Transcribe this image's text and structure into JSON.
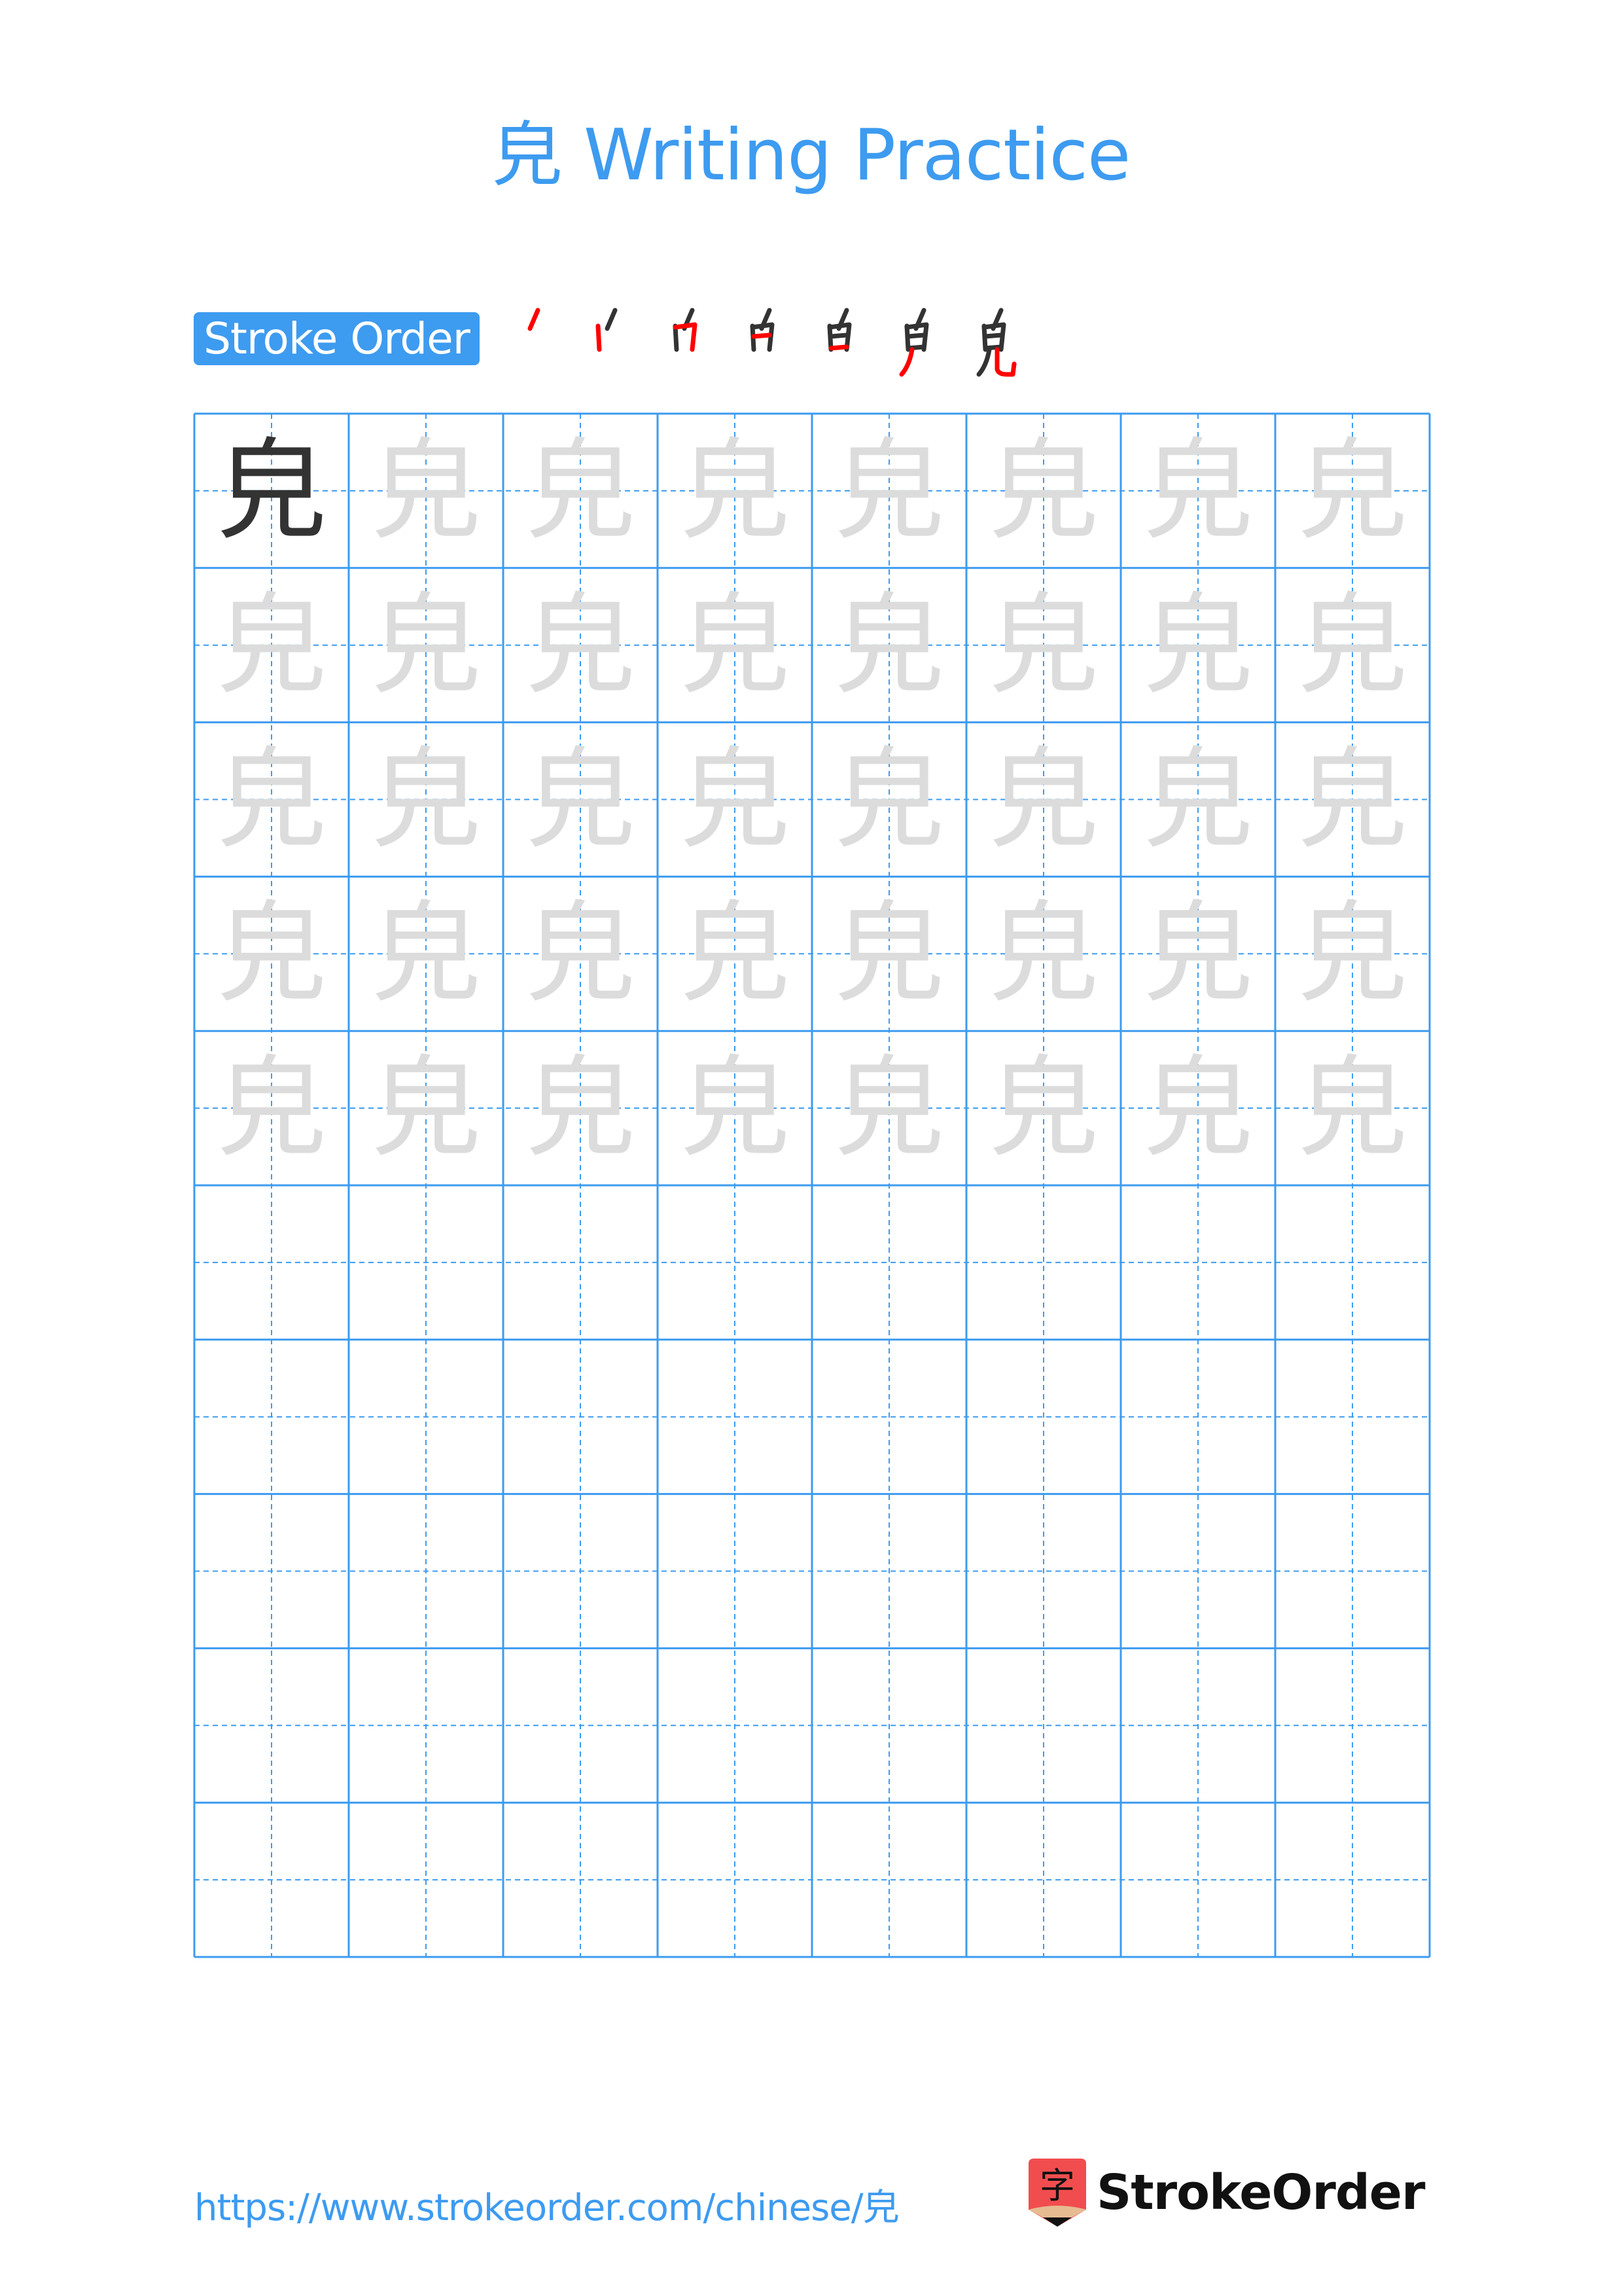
{
  "header": {
    "title": "皃 Writing Practice",
    "character": "皃"
  },
  "stroke_order": {
    "label": "Stroke Order",
    "steps_count": 7,
    "total_strokes": 7,
    "colors": {
      "current_stroke": "#ff0000",
      "previous_strokes": "#333333"
    }
  },
  "grid": {
    "columns": 8,
    "rows": 10,
    "model_character": "皃",
    "trace_character": "皃",
    "trace_rows": 5,
    "blank_rows": 5,
    "line_color": "#3d9bf0",
    "trace_color": "#dcdcdc",
    "model_color": "#333333"
  },
  "footer": {
    "url": "https://www.strokeorder.com/chinese/皃",
    "brand": "StrokeOrder",
    "brand_icon_glyph": "字"
  }
}
